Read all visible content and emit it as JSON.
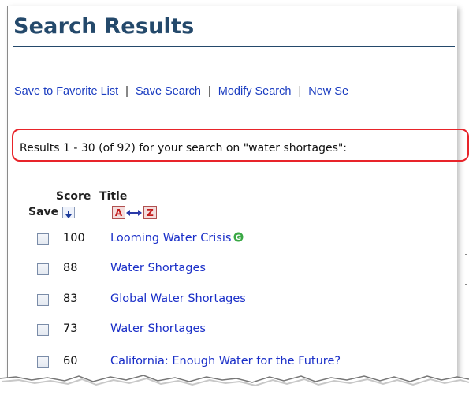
{
  "header": {
    "title": "Search Results"
  },
  "toolbar": {
    "links": [
      "Save to Favorite List",
      "Save Search",
      "Modify Search",
      "New Se"
    ],
    "separator": "|"
  },
  "results": {
    "summary": "Results 1 - 30 (of 92) for your search on \"water shortages\":"
  },
  "table": {
    "score_header": "Score",
    "title_header": "Title",
    "save_header": "Save",
    "rows": [
      {
        "score": "100",
        "title": "Looming Water Crisis",
        "has_badge": true
      },
      {
        "score": "88",
        "title": "Water Shortages"
      },
      {
        "score": "83",
        "title": "Global Water Shortages"
      },
      {
        "score": "73",
        "title": "Water Shortages"
      },
      {
        "score": "60",
        "title": "California: Enough Water for the Future?"
      }
    ]
  },
  "colors": {
    "title": "#24496b",
    "link": "#1a2fc8",
    "highlight_border": "#e8242a",
    "badge": "#3aa845"
  },
  "icons": {
    "sort_score": "sort-down-arrow-icon",
    "sort_title": "sort-a-to-z-icon",
    "badge": "green-g-badge-icon"
  }
}
